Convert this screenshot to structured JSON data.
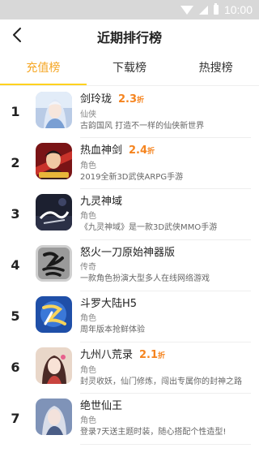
{
  "status_bar": {
    "time": "10:00"
  },
  "header": {
    "title": "近期排行榜"
  },
  "tabs": [
    {
      "label": "充值榜",
      "active": true
    },
    {
      "label": "下载榜",
      "active": false
    },
    {
      "label": "热搜榜",
      "active": false
    }
  ],
  "colors": {
    "accent": "#f5a623",
    "tab_indicator": "#ffd21e",
    "discount": "#f5841f",
    "status_bar": "#d8d8d8"
  },
  "games": [
    {
      "rank": "1",
      "name": "剑玲珑",
      "discount": "2.3",
      "discount_unit": "折",
      "category": "仙侠",
      "desc": "古韵国风 打造不一样的仙侠新世界",
      "icon": "fairy-woman-icon"
    },
    {
      "rank": "2",
      "name": "热血神剑",
      "discount": "2.4",
      "discount_unit": "折",
      "category": "角色",
      "desc": "2019全新3D武侠ARPG手游",
      "icon": "swordsman-icon"
    },
    {
      "rank": "3",
      "name": "九灵神域",
      "discount": "",
      "discount_unit": "",
      "category": "角色",
      "desc": "《九灵神域》是一款3D武侠MMO手游",
      "icon": "jiuling-logo-icon"
    },
    {
      "rank": "4",
      "name": "怒火一刀原始神器版",
      "discount": "",
      "discount_unit": "",
      "category": "传奇",
      "desc": "一款角色扮演大型多人在线网络游戏",
      "icon": "nu-calligraphy-icon"
    },
    {
      "rank": "5",
      "name": "斗罗大陆H5",
      "discount": "",
      "discount_unit": "",
      "category": "角色",
      "desc": "周年版本抢鲜体验",
      "icon": "douluo-logo-icon"
    },
    {
      "rank": "6",
      "name": "九州八荒录",
      "discount": "2.1",
      "discount_unit": "折",
      "category": "角色",
      "desc": "封灵收妖，仙门修炼，闯出专属你的封神之路",
      "icon": "anime-girl-icon"
    },
    {
      "rank": "7",
      "name": "绝世仙王",
      "discount": "",
      "discount_unit": "",
      "category": "角色",
      "desc": "登录7天送主题时装，随心搭配个性造型!",
      "icon": "silver-hair-woman-icon"
    }
  ]
}
